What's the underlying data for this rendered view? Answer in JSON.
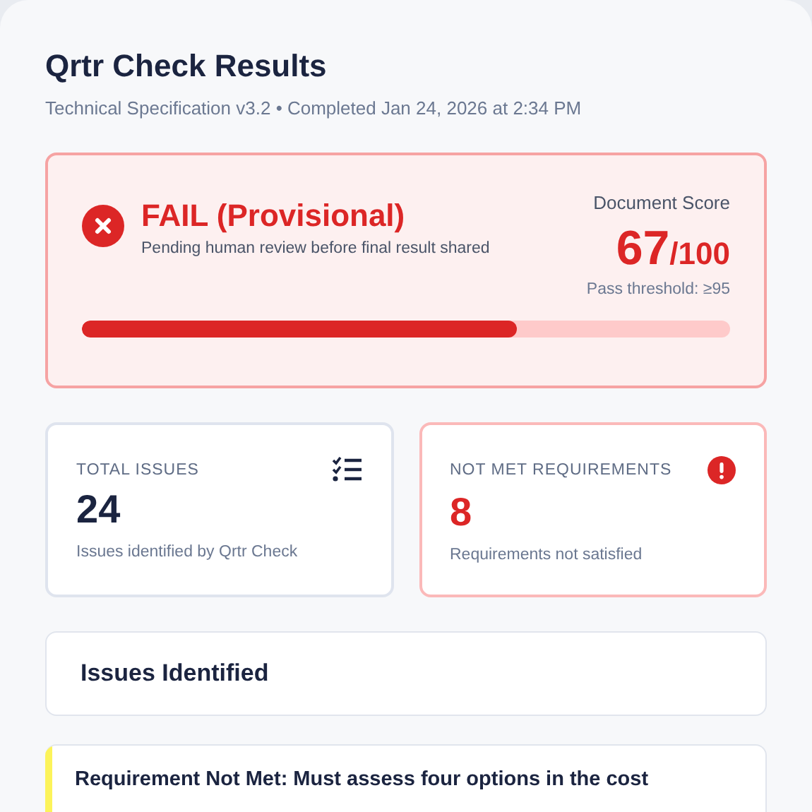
{
  "header": {
    "title": "Qrtr Check Results",
    "subtitle": "Technical Specification v3.2 • Completed Jan 24, 2026 at 2:34 PM"
  },
  "result": {
    "kind": "fail",
    "title": "FAIL (Provisional)",
    "note": "Pending human review before final result shared",
    "score_label": "Document Score",
    "score": "67",
    "score_total": "/100",
    "threshold": "Pass threshold: ≥95",
    "level": 0.67
  },
  "stats": [
    {
      "kind": "total",
      "label": "TOTAL ISSUES",
      "value": "24",
      "caption": "Issues identified by Qrtr Check"
    },
    {
      "kind": "alert",
      "label": "NOT MET REQUIREMENTS",
      "value": "8",
      "caption": "Requirements not satisfied"
    }
  ],
  "issues_section": {
    "title": "Issues Identified"
  },
  "issues": [
    {
      "title": "Requirement Not Met: Must assess four options in the cost",
      "color": "#fcf35a"
    }
  ]
}
